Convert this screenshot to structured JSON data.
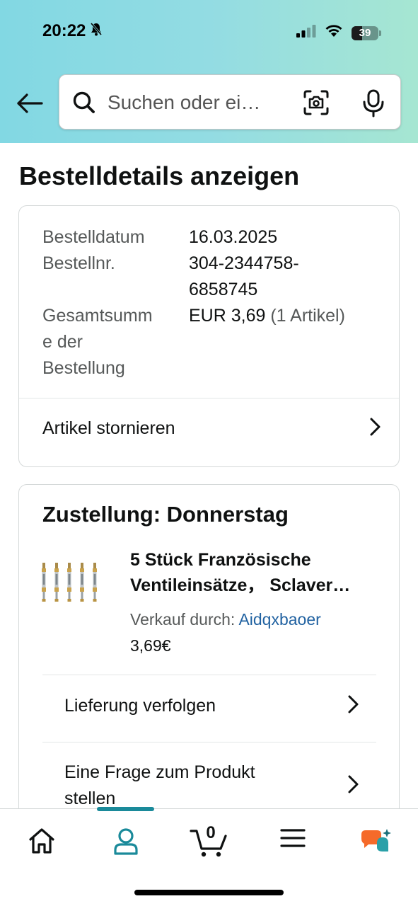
{
  "status_bar": {
    "time": "20:22",
    "battery": "39",
    "battery_level": 0.39
  },
  "search": {
    "placeholder": "Suchen oder ei…"
  },
  "page": {
    "title": "Bestelldetails anzeigen"
  },
  "order": {
    "date_label": "Bestelldatum",
    "date_value": "16.03.2025",
    "number_label": "Bestellnr.",
    "number_value_line1": "304-2344758-",
    "number_value_line2": "6858745",
    "total_label_line1": "Gesamtsumm",
    "total_label_line2": "e der",
    "total_label_line3": "Bestellung",
    "total_value": "EUR 3,69",
    "total_items": "(1 Artikel)",
    "cancel_label": "Artikel stornieren"
  },
  "delivery": {
    "title": "Zustellung: Donnerstag",
    "product_title_line1": "5 Stück Französische",
    "product_title_line2": "Ventileinsätze， Sclaver…",
    "seller_label": "Verkauf durch:",
    "seller_name": "Aidqxbaoer",
    "price": "3,69€",
    "track_label": "Lieferung verfolgen",
    "question_label_line1": "Eine Frage zum Produkt",
    "question_label_line2": "stellen"
  },
  "bottom_nav": {
    "cart_count": "0",
    "accent_color": "#1a8a9a"
  }
}
